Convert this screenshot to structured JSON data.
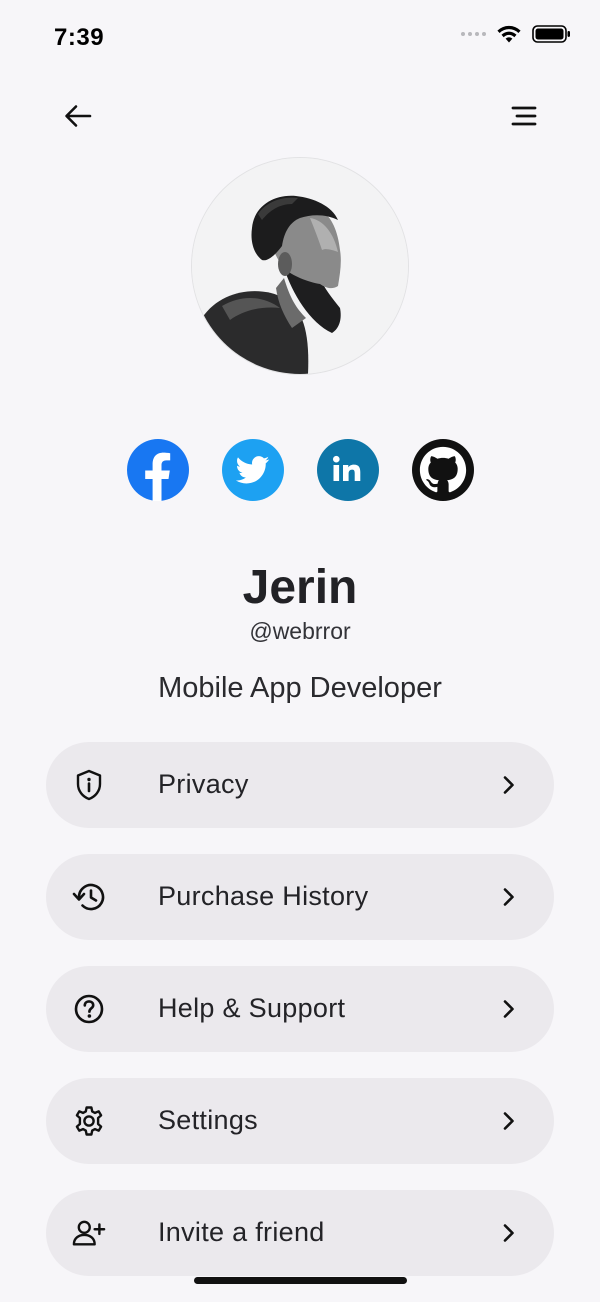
{
  "status_bar": {
    "time": "7:39",
    "icons": [
      "signal-dots-icon",
      "wifi-icon",
      "battery-icon"
    ]
  },
  "top_bar": {
    "back_icon": "arrow-left-icon",
    "menu_icon": "menu-lines-icon"
  },
  "profile": {
    "avatar_icon": "profile-photo",
    "name": "Jerin",
    "handle": "@webrror",
    "role": "Mobile App Developer"
  },
  "socials": [
    {
      "icon": "facebook-icon",
      "color": "#1877f2"
    },
    {
      "icon": "twitter-icon",
      "color": "#1da1f2"
    },
    {
      "icon": "linkedin-icon",
      "color": "#0e76a8"
    },
    {
      "icon": "github-icon",
      "color": "#111111"
    }
  ],
  "menu": {
    "items": [
      {
        "label": "Privacy",
        "icon": "shield-info-icon"
      },
      {
        "label": "Purchase History",
        "icon": "history-icon"
      },
      {
        "label": "Help & Support",
        "icon": "help-circle-icon"
      },
      {
        "label": "Settings",
        "icon": "gear-icon"
      },
      {
        "label": "Invite a friend",
        "icon": "add-user-icon"
      }
    ],
    "chevron_icon": "chevron-right-icon"
  },
  "colors": {
    "background": "#f7f6f9",
    "menu_item_bg": "#ebe9ed",
    "text": "#222226"
  }
}
